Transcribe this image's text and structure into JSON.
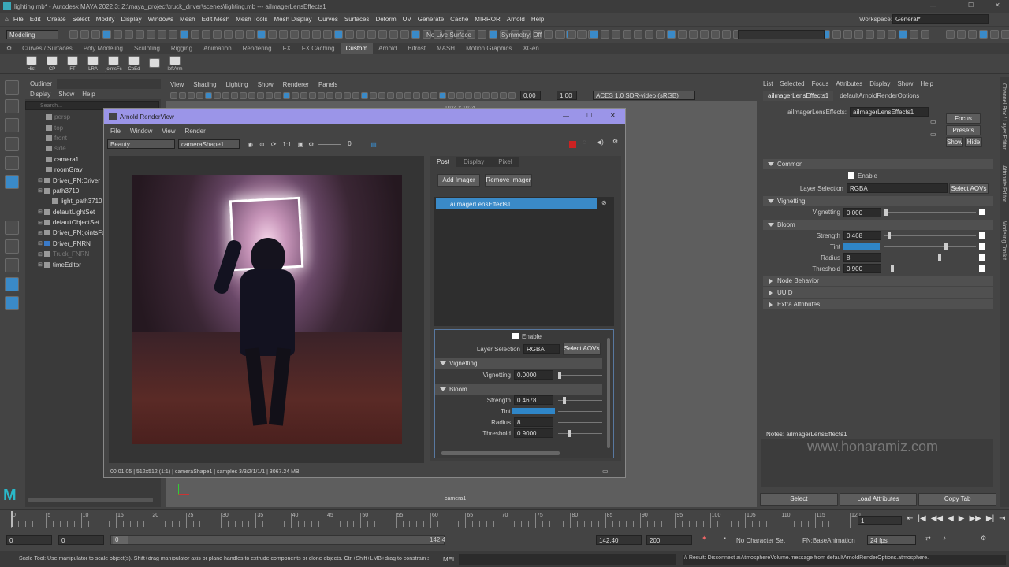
{
  "title_bar": {
    "text": "lighting.mb* - Autodesk MAYA 2022.3: Z:\\maya_project\\truck_driver\\scenes\\lighting.mb  ---   aiImagerLensEffects1"
  },
  "menubar": [
    "File",
    "Edit",
    "Create",
    "Select",
    "Modify",
    "Display",
    "Windows",
    "Mesh",
    "Edit Mesh",
    "Mesh Tools",
    "Mesh Display",
    "Curves",
    "Surfaces",
    "Deform",
    "UV",
    "Generate",
    "Cache",
    "MIRROR",
    "Arnold",
    "Help"
  ],
  "workspace": {
    "label": "Workspace:",
    "value": "General*"
  },
  "status_line": {
    "mode": "Modeling",
    "live_surface": "No Live Surface",
    "symmetry": "Symmetry: Off"
  },
  "shelf_tabs": [
    "Curves / Surfaces",
    "Poly Modeling",
    "Sculpting",
    "Rigging",
    "Animation",
    "Rendering",
    "FX",
    "FX Caching",
    "Custom",
    "Arnold",
    "Bifrost",
    "MASH",
    "Motion Graphics",
    "XGen"
  ],
  "shelf_icons": [
    "Hist",
    "CP",
    "FT",
    "LRA",
    "jointsFc",
    "CpEd",
    "",
    "leftArm"
  ],
  "outliner": {
    "title": "Outliner",
    "menus": [
      "Display",
      "Show",
      "Help"
    ],
    "search_placeholder": "Search...",
    "items": [
      "persp",
      "top",
      "front",
      "side",
      "camera1",
      "roomGray",
      "Driver_FN:Driver",
      "path3710",
      "light_path3710",
      "defaultLightSet",
      "defaultObjectSet",
      "Driver_FN:jointsFo",
      "Driver_FNRN",
      "Truck_FNRN",
      "timeEditor"
    ]
  },
  "viewport": {
    "menus": [
      "View",
      "Shading",
      "Lighting",
      "Show",
      "Renderer",
      "Panels"
    ],
    "gamma": "0.00",
    "exposure": "1.00",
    "color_space": "ACES 1.0 SDR-video (sRGB)",
    "resolution": "1024 x 1024",
    "camera_label": "camera1"
  },
  "render_view": {
    "title": "Arnold RenderView",
    "menus": [
      "File",
      "Window",
      "View",
      "Render"
    ],
    "aov": "Beauty",
    "camera": "cameraShape1",
    "ratio": "1:1",
    "exposure": "0",
    "tabs": [
      "Post",
      "Display",
      "Pixel"
    ],
    "add_imager": "Add Imager",
    "remove_imager": "Remove Imager",
    "imager_item": "aiImagerLensEffects1",
    "enable": "Enable",
    "layer_selection_label": "Layer Selection",
    "layer_selection": "RGBA",
    "select_aovs": "Select AOVs",
    "vignetting_section": "Vignetting",
    "vignetting_label": "Vignetting",
    "vignetting": "0.0000",
    "bloom_section": "Bloom",
    "strength_label": "Strength",
    "strength": "0.4678",
    "tint_label": "Tint",
    "radius_label": "Radius",
    "radius": "8",
    "threshold_label": "Threshold",
    "threshold": "0.9000",
    "status": "00:01:05 | 512x512 (1:1) | cameraShape1 | samples 3/3/2/1/1/1 | 3067.24 MB"
  },
  "channel_box": {
    "menus": [
      "List",
      "Selected",
      "Focus",
      "Attributes",
      "Display",
      "Show",
      "Help"
    ],
    "tabs": [
      "aiImagerLensEffects1",
      "defaultArnoldRenderOptions"
    ],
    "node_label": "aiImagerLensEffects:",
    "node_value": "aiImagerLensEffects1",
    "focus": "Focus",
    "presets": "Presets",
    "show": "Show",
    "hide": "Hide",
    "common": "Common",
    "enable": "Enable",
    "layer_selection_label": "Layer Selection",
    "layer_selection": "RGBA",
    "select_aovs": "Select AOVs",
    "vignetting_section": "Vignetting",
    "vignetting_label": "Vignetting",
    "vignetting": "0.000",
    "bloom_section": "Bloom",
    "strength_label": "Strength",
    "strength": "0.468",
    "tint_label": "Tint",
    "radius_label": "Radius",
    "radius": "8",
    "threshold_label": "Threshold",
    "threshold": "0.900",
    "node_behavior": "Node Behavior",
    "uuid": "UUID",
    "extra_attributes": "Extra Attributes",
    "notes": "Notes:  aiImagerLensEffects1",
    "watermark": "www.honaramiz.com",
    "bottom_buttons": [
      "Select",
      "Load Attributes",
      "Copy Tab"
    ],
    "side_tabs": [
      "Channel Box / Layer Editor",
      "Attribute Editor",
      "Modeling Toolkit"
    ]
  },
  "timeline": {
    "ticks": [
      "0",
      "5",
      "10",
      "15",
      "20",
      "25",
      "30",
      "35",
      "40",
      "45",
      "50",
      "55",
      "60",
      "65",
      "70",
      "75",
      "80",
      "85",
      "90",
      "95",
      "100",
      "105",
      "110",
      "115",
      "120"
    ],
    "current_frame": "1"
  },
  "range": {
    "start": "0",
    "playback_start": "0",
    "range_start": "0",
    "range_end": "142.4",
    "end": "142.40",
    "anim_end": "200",
    "character_set": "No Character Set",
    "anim_layer": "FN:BaseAnimation",
    "fps": "24 fps"
  },
  "help_line": {
    "text": "Scale Tool: Use manipulator to scale object(s). Shift+drag manipulator axis or plane handles to extrude components or clone objects. Ctrl+Shift+LMB+drag to constrain scaling to",
    "mel": "MEL",
    "result": "// Result: Disconnect aiAtmosphereVolume.message from defaultArnoldRenderOptions.atmosphere."
  },
  "colors": {
    "accent": "#3a8ac8",
    "tint": "#2f86c8",
    "render_title": "#9b95e8"
  }
}
